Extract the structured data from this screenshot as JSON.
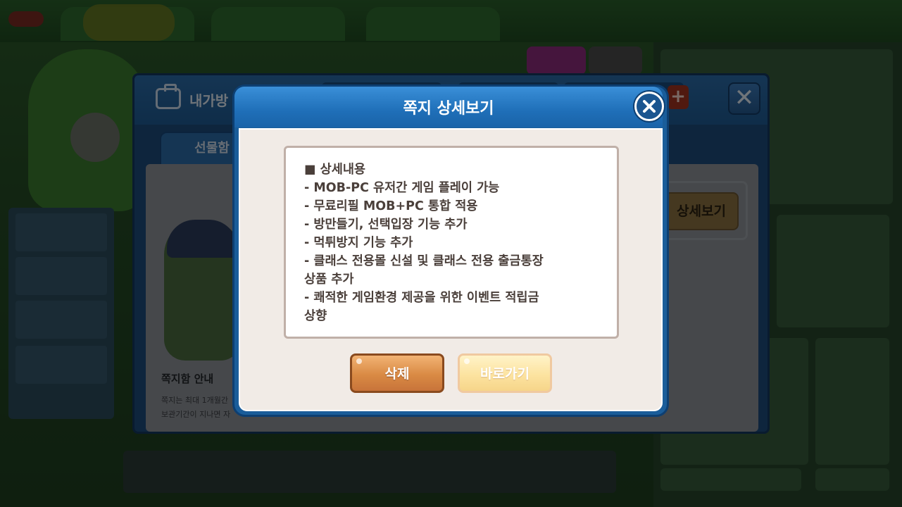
{
  "modal": {
    "title": "쪽지 상세보기",
    "content_lines": [
      "■ 상세내용",
      "- MOB-PC 유저간 게임 플레이 가능",
      "- 무료리필 MOB+PC 통합 적용",
      "- 방만들기, 선택입장 기능 추가",
      "- 먹튀방지 기능 추가",
      "- 클래스 전용몰 신설 및 클래스 전용 출금통장",
      "상품 추가",
      "- 쾌적한 게임환경 제공을 위한 이벤트 적립금",
      "상향"
    ],
    "delete_label": "삭제",
    "goto_label": "바로가기"
  },
  "mailbox": {
    "title": "내가방",
    "tab_gift": "선물함",
    "note_title": "쪽지함 안내",
    "note_text_1": "쪽지는 최대 1개월간",
    "note_text_2": "보관기간이 지나면 자",
    "view_button": "상세보기"
  },
  "colors": {
    "header_blue": "#1f6fb8",
    "panel_bg": "#f1ebe6",
    "delete_orange": "#d98a44",
    "goto_yellow": "#fce3a0",
    "text_brown": "#4a3f3a"
  }
}
